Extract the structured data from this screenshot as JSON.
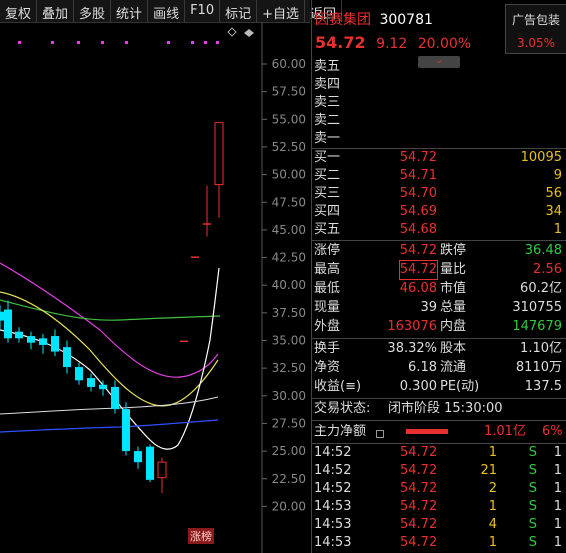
{
  "toolbar": {
    "buttons": [
      "复权",
      "叠加",
      "多股",
      "统计",
      "画线",
      "F10",
      "标记",
      "+自选",
      "返回"
    ]
  },
  "chart": {
    "y_ticks": [
      "60.00",
      "57.50",
      "55.00",
      "52.50",
      "50.00",
      "47.50",
      "45.00",
      "42.50",
      "40.00",
      "37.50",
      "35.00",
      "32.50",
      "30.00",
      "27.50",
      "25.00",
      "22.50",
      "20.00"
    ],
    "limit_up_tag": "涨榜",
    "colors": {
      "up": "#e83030",
      "down": "#00e5ff",
      "ma_white": "#ffffff",
      "ma_yellow": "#e8e060",
      "ma_magenta": "#e040e0",
      "ma_green": "#40c040",
      "ma_blue": "#3050ff"
    }
  },
  "quote": {
    "name": "因赛集团",
    "code": "300781",
    "price": "54.72",
    "change": "9.12",
    "change_pct": "20.00%",
    "ad_label": "广告包装",
    "ad_pct": "3.05%"
  },
  "ask": [
    {
      "label": "卖五",
      "price": "",
      "vol": ""
    },
    {
      "label": "卖四",
      "price": "",
      "vol": ""
    },
    {
      "label": "卖三",
      "price": "",
      "vol": ""
    },
    {
      "label": "卖二",
      "price": "",
      "vol": ""
    },
    {
      "label": "卖一",
      "price": "",
      "vol": ""
    }
  ],
  "bid": [
    {
      "label": "买一",
      "price": "54.72",
      "vol": "10095"
    },
    {
      "label": "买二",
      "price": "54.71",
      "vol": "9"
    },
    {
      "label": "买三",
      "price": "54.70",
      "vol": "56"
    },
    {
      "label": "买四",
      "price": "54.69",
      "vol": "34"
    },
    {
      "label": "买五",
      "price": "54.68",
      "vol": "1"
    }
  ],
  "stats": [
    {
      "l1": "涨停",
      "v1": "54.72",
      "c1": "r",
      "l2": "跌停",
      "v2": "36.48",
      "c2": "g"
    },
    {
      "l1": "最高",
      "v1": "54.72",
      "c1": "r",
      "l2": "量比",
      "v2": "2.56",
      "c2": "r"
    },
    {
      "l1": "最低",
      "v1": "46.08",
      "c1": "r",
      "l2": "市值",
      "v2": "60.2亿",
      "c2": "w"
    },
    {
      "l1": "现量",
      "v1": "39",
      "c1": "w",
      "l2": "总量",
      "v2": "310755",
      "c2": "w"
    },
    {
      "l1": "外盘",
      "v1": "163076",
      "c1": "r",
      "l2": "内盘",
      "v2": "147679",
      "c2": "g"
    }
  ],
  "stats2": [
    {
      "l1": "换手",
      "v1": "38.32%",
      "l2": "股本",
      "v2": "1.10亿"
    },
    {
      "l1": "净资",
      "v1": "6.18",
      "l2": "流通",
      "v2": "8110万"
    },
    {
      "l1": "收益(≡)",
      "v1": "0.300",
      "l2": "PE(动)",
      "v2": "137.5"
    }
  ],
  "status": {
    "label": "交易状态:",
    "value": "闭市阶段 15:30:00"
  },
  "net": {
    "label": "主力净额",
    "value": "1.01亿",
    "pct": "6%"
  },
  "ticks": [
    {
      "t": "14:52",
      "p": "54.72",
      "v": "1",
      "s": "S",
      "n": "1"
    },
    {
      "t": "14:52",
      "p": "54.72",
      "v": "21",
      "s": "S",
      "n": "1"
    },
    {
      "t": "14:52",
      "p": "54.72",
      "v": "2",
      "s": "S",
      "n": "1"
    },
    {
      "t": "14:53",
      "p": "54.72",
      "v": "1",
      "s": "S",
      "n": "1"
    },
    {
      "t": "14:53",
      "p": "54.72",
      "v": "4",
      "s": "S",
      "n": "1"
    },
    {
      "t": "14:53",
      "p": "54.72",
      "v": "1",
      "s": "S",
      "n": "1"
    }
  ]
}
